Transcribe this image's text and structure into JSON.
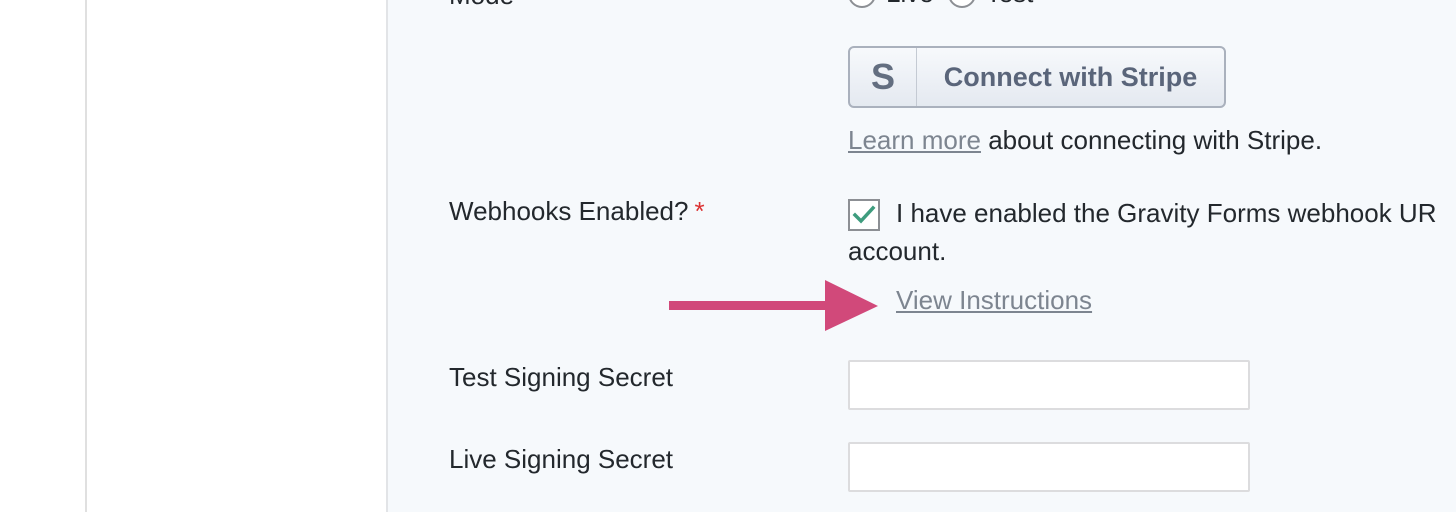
{
  "mode": {
    "label": "Mode",
    "options": [
      {
        "label": "Live",
        "selected": true
      },
      {
        "label": "Test",
        "selected": false
      }
    ]
  },
  "stripe": {
    "logo_letter": "S",
    "button_label": "Connect with Stripe",
    "learn_more_link": "Learn more",
    "learn_more_suffix": " about connecting with Stripe."
  },
  "webhooks": {
    "label": "Webhooks Enabled?",
    "required_mark": "*",
    "checkbox_checked": true,
    "checkbox_text_line1": "I have enabled the Gravity Forms webhook UR",
    "checkbox_text_line2": "account.",
    "view_instructions": "View Instructions"
  },
  "test_signing_secret": {
    "label": "Test Signing Secret",
    "value": ""
  },
  "live_signing_secret": {
    "label": "Live Signing Secret",
    "value": ""
  },
  "colors": {
    "accent_green": "#3e9c7e",
    "annotation_arrow": "#d1497a",
    "required_red": "#dc3232",
    "content_bg": "#f6f9fc"
  }
}
